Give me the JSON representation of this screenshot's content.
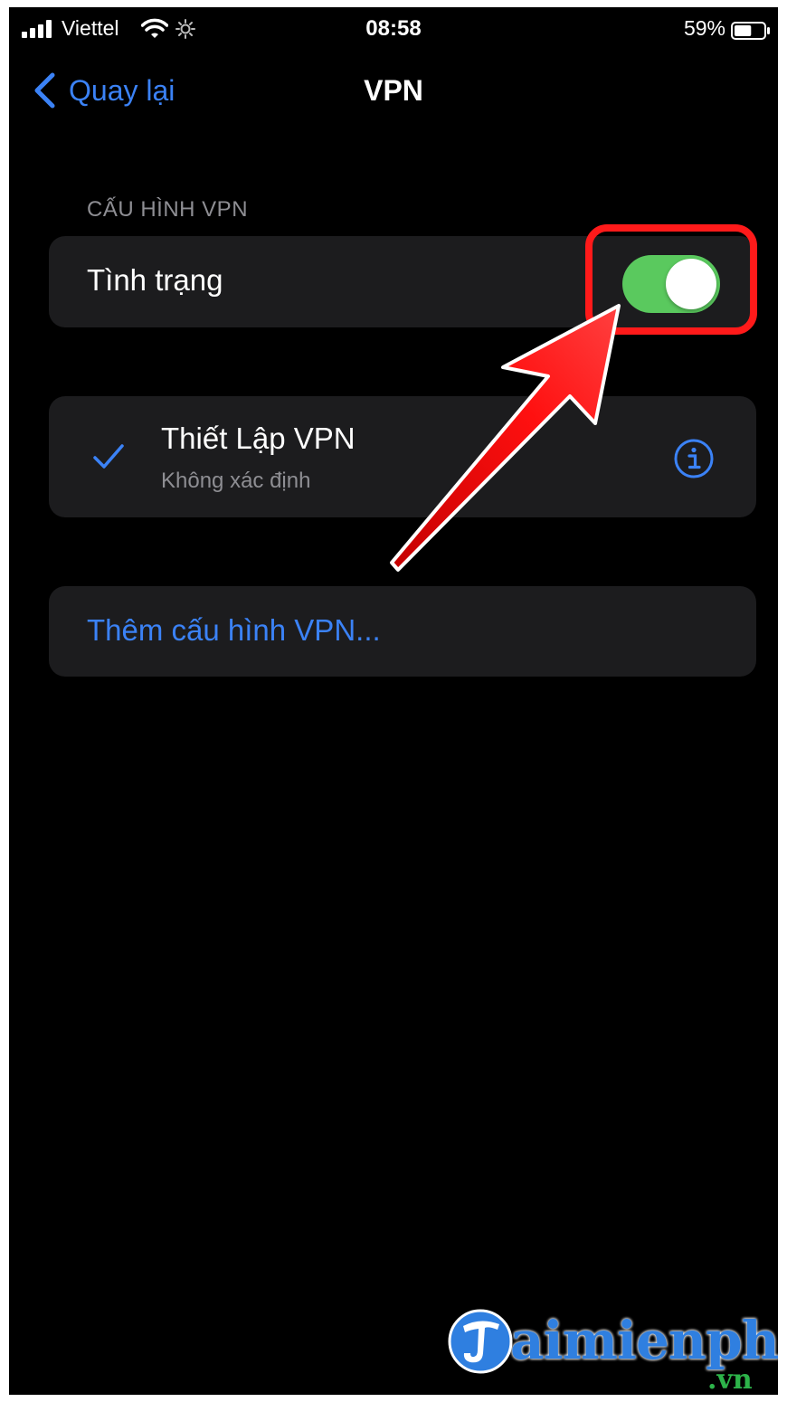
{
  "status_bar": {
    "carrier": "Viettel",
    "time": "08:58",
    "battery_percent": "59%",
    "battery_level": 0.59,
    "icons": [
      "signal-icon",
      "wifi-icon",
      "brightness-icon",
      "battery-icon"
    ]
  },
  "nav": {
    "back_label": "Quay lại",
    "title": "VPN"
  },
  "section": {
    "header": "CẤU HÌNH VPN"
  },
  "status_row": {
    "label": "Tình trạng",
    "toggle_on": true
  },
  "vpn_config": {
    "name": "Thiết Lập VPN",
    "status": "Không xác định",
    "selected": true
  },
  "add_config": {
    "label": "Thêm cấu hình VPN..."
  },
  "watermark": {
    "text": "aimienphi",
    "suffix": ".vn"
  },
  "colors": {
    "background": "#000000",
    "card": "#1c1c1e",
    "accent_blue": "#3b82f6",
    "toggle_green": "#5ac95e",
    "annotation_red": "#ff1a1a",
    "secondary_text": "#8e8e93"
  }
}
